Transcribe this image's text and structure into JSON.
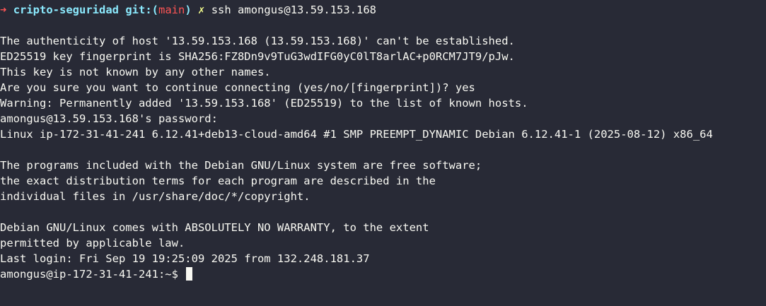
{
  "prompt": {
    "arrow": "➜",
    "dir": "cripto-seguridad",
    "git_label": "git:",
    "open_paren": "(",
    "branch": "main",
    "close_paren": ")",
    "dirty_marker": "✗",
    "command": "ssh amongus@13.59.153.168"
  },
  "output_lines": [
    "",
    "The authenticity of host '13.59.153.168 (13.59.153.168)' can't be established.",
    "ED25519 key fingerprint is SHA256:FZ8Dn9v9TuG3wdIFG0yC0lT8arlAC+p0RCM7JT9/pJw.",
    "This key is not known by any other names.",
    "Are you sure you want to continue connecting (yes/no/[fingerprint])? yes",
    "Warning: Permanently added '13.59.153.168' (ED25519) to the list of known hosts.",
    "amongus@13.59.153.168's password:",
    "Linux ip-172-31-41-241 6.12.41+deb13-cloud-amd64 #1 SMP PREEMPT_DYNAMIC Debian 6.12.41-1 (2025-08-12) x86_64",
    "",
    "The programs included with the Debian GNU/Linux system are free software;",
    "the exact distribution terms for each program are described in the",
    "individual files in /usr/share/doc/*/copyright.",
    "",
    "Debian GNU/Linux comes with ABSOLUTELY NO WARRANTY, to the extent",
    "permitted by applicable law.",
    "Last login: Fri Sep 19 19:25:09 2025 from 132.248.181.37"
  ],
  "remote_prompt": "amongus@ip-172-31-41-241:~$ ",
  "colors": {
    "background": "#282a36",
    "foreground": "#f8f8f2",
    "cyan": "#8be9fd",
    "red": "#ff5555",
    "yellow": "#f1fa8c"
  }
}
